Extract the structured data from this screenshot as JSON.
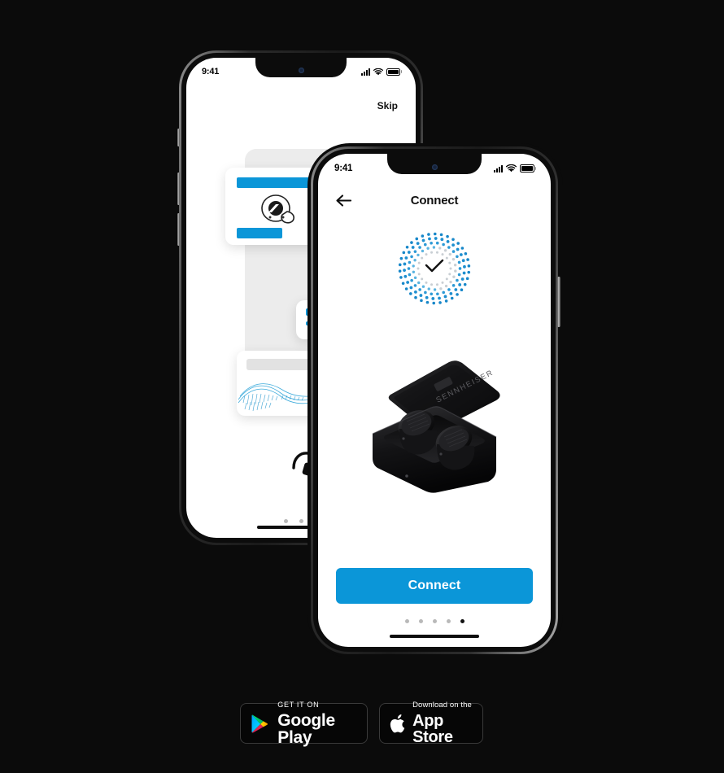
{
  "page": {
    "background_color": "#0b0b0b",
    "accent_blue": "#0b96d8"
  },
  "back_phone": {
    "status_bar": {
      "time": "9:41",
      "signal_icon": "cellular-bars-icon",
      "wifi_icon": "wifi-icon",
      "battery_icon": "battery-icon"
    },
    "skip_label": "Skip",
    "cards": [
      {
        "name": "earbuds-card",
        "title_bar": "",
        "button_bar": ""
      },
      {
        "name": "text-card",
        "line1": "",
        "line2": ""
      },
      {
        "name": "equalizer-card",
        "label_bar": ""
      }
    ],
    "headphone_icon": "headphone-icon",
    "page_dots": {
      "count": 3,
      "active_index": -1
    }
  },
  "front_phone": {
    "status_bar": {
      "time": "9:41",
      "signal_icon": "cellular-bars-icon",
      "wifi_icon": "wifi-icon",
      "battery_icon": "battery-icon"
    },
    "nav": {
      "back_icon": "back-arrow-icon",
      "title": "Connect"
    },
    "status_indicator": {
      "icon": "checkmark-icon",
      "animation": "pairing-dots-ring"
    },
    "product_image": {
      "name": "sennheiser-charging-case",
      "brand_text": "SENNHEISER"
    },
    "primary_button": {
      "label": "Connect",
      "color": "#0b96d8"
    },
    "page_dots": {
      "count": 5,
      "active_index": 4
    },
    "home_indicator": "home-indicator"
  },
  "store_badges": [
    {
      "name": "google-play-badge",
      "small": "GET IT ON",
      "big": "Google Play",
      "icon": "google-play-icon"
    },
    {
      "name": "app-store-badge",
      "small": "Download on the",
      "big": "App Store",
      "icon": "apple-logo-icon"
    }
  ]
}
